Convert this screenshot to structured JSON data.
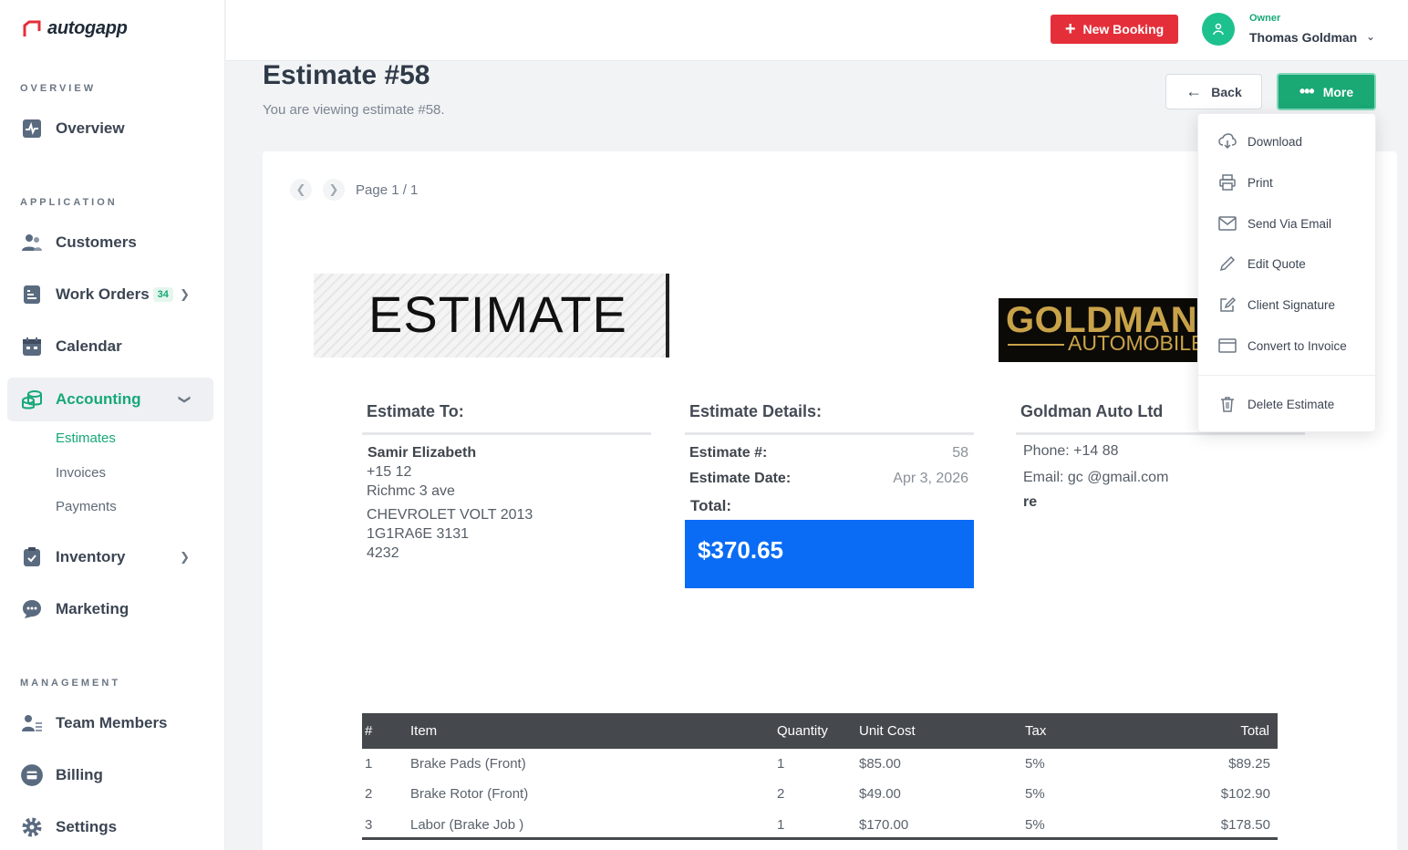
{
  "app": {
    "logo_text": "autogapp"
  },
  "sidebar": {
    "sections": {
      "overview": "OVERVIEW",
      "application": "APPLICATION",
      "management": "MANAGEMENT"
    },
    "items": {
      "overview": "Overview",
      "customers": "Customers",
      "work_orders": "Work Orders",
      "work_orders_badge": "34",
      "calendar": "Calendar",
      "accounting": "Accounting",
      "inventory": "Inventory",
      "marketing": "Marketing",
      "team_members": "Team Members",
      "billing": "Billing",
      "settings": "Settings"
    },
    "accounting_sub": {
      "estimates": "Estimates",
      "invoices": "Invoices",
      "payments": "Payments"
    }
  },
  "topbar": {
    "new_booking": "New Booking",
    "owner_role": "Owner",
    "owner_name": "Thomas Goldman"
  },
  "header": {
    "title": "Estimate #58",
    "subtitle": "You are viewing estimate #58.",
    "back": "Back",
    "more": "More"
  },
  "pager": {
    "label": "Page 1 / 1"
  },
  "document": {
    "banner": "ESTIMATE",
    "logo_line1": "GOLDMANN",
    "logo_line2": "AUTOMOBILE",
    "estimate_to": {
      "heading": "Estimate To:",
      "name": "Samir Elizabeth",
      "phone": "+15           12",
      "address": "Richmc           3 ave",
      "vehicle": "CHEVROLET VOLT 2013",
      "vin": "1G1RA6E           3131",
      "code": "4232"
    },
    "details": {
      "heading": "Estimate Details:",
      "number_label": "Estimate #:",
      "number_value": "58",
      "date_label": "Estimate Date:",
      "date_value": "Apr 3, 2026",
      "total_label": "Total:",
      "total_value": "$370.65"
    },
    "company": {
      "heading": "Goldman Auto Ltd",
      "phone": "Phone: +14           88",
      "email": "Email: gc           @gmail.com",
      "extra": "re"
    },
    "table": {
      "headers": [
        "#",
        "Item",
        "Quantity",
        "Unit Cost",
        "Tax",
        "Total"
      ],
      "rows": [
        [
          "1",
          "Brake Pads (Front)",
          "1",
          "$85.00",
          "5%",
          "$89.25"
        ],
        [
          "2",
          "Brake Rotor (Front)",
          "2",
          "$49.00",
          "5%",
          "$102.90"
        ],
        [
          "3",
          "Labor (Brake Job )",
          "1",
          "$170.00",
          "5%",
          "$178.50"
        ]
      ]
    }
  },
  "menu": {
    "download": "Download",
    "print": "Print",
    "send_email": "Send Via Email",
    "edit_quote": "Edit Quote",
    "client_signature": "Client Signature",
    "convert_invoice": "Convert to Invoice",
    "delete_estimate": "Delete Estimate"
  },
  "colors": {
    "accent_green": "#17a877",
    "danger_red": "#e42f3a",
    "total_blue": "#0a6cf5"
  }
}
